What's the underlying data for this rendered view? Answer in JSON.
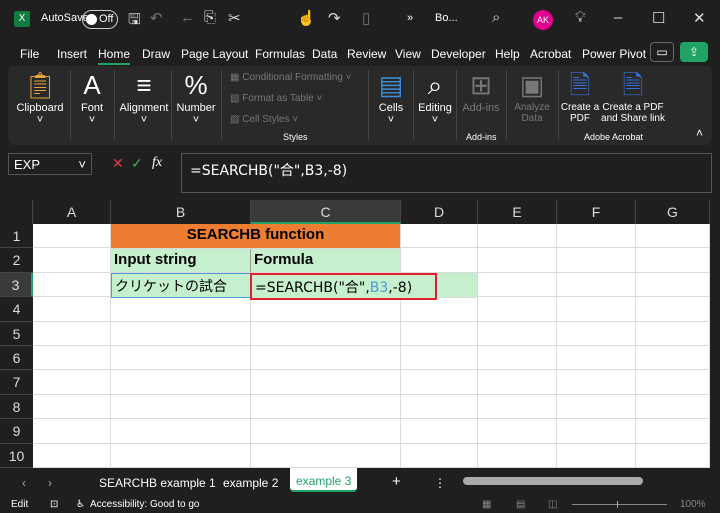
{
  "titlebar": {
    "app_icon": "excel-icon",
    "autosave_label": "AutoSave",
    "autosave_state": "Off",
    "doc_name": "Bo...",
    "avatar": "AK",
    "more": "»"
  },
  "menu": [
    "File",
    "Insert",
    "Home",
    "Draw",
    "Page Layout",
    "Formulas",
    "Data",
    "Review",
    "View",
    "Developer",
    "Help",
    "Acrobat",
    "Power Pivot"
  ],
  "ribbon": {
    "clipboard": "Clipboard",
    "font": "Font",
    "alignment": "Alignment",
    "number": "Number",
    "conditional": "Conditional Formatting",
    "format_table": "Format as Table",
    "cell_styles": "Cell Styles",
    "styles": "Styles",
    "cells": "Cells",
    "editing": "Editing",
    "addins": "Add-ins",
    "addins_group": "Add-ins",
    "analyze": "Analyze Data",
    "create_pdf": "Create a PDF",
    "create_share": "Create a PDF and Share link",
    "acrobat_group": "Adobe Acrobat"
  },
  "formula_bar": {
    "name_box": "EXP",
    "fx": "fx",
    "formula": "=SEARCHB(\"合\",B3,-8)"
  },
  "columns": [
    "A",
    "B",
    "C",
    "D",
    "E",
    "F",
    "G"
  ],
  "rows": [
    "1",
    "2",
    "3",
    "4",
    "5",
    "6",
    "7",
    "8",
    "9",
    "10"
  ],
  "cells": {
    "title": "SEARCHB function",
    "h_input": "Input string",
    "h_formula": "Formula",
    "b3": "クリケットの試合",
    "c3_pre": "=SEARCHB(\"合\",",
    "c3_ref": "B3",
    "c3_post": ",-8)"
  },
  "colors": {
    "header_orange": "#ed7d31",
    "green_fill": "#c6efce",
    "ref_blue": "#4a9bd6",
    "edit_border": "#e0202a",
    "accent": "#21a366"
  },
  "sheets": {
    "tabs": [
      "SEARCHB example 1",
      "example 2",
      "example 3"
    ],
    "active": "example 3",
    "add": "+"
  },
  "status": {
    "mode": "Edit",
    "accessibility": "Accessibility: Good to go",
    "zoom": "100%"
  }
}
